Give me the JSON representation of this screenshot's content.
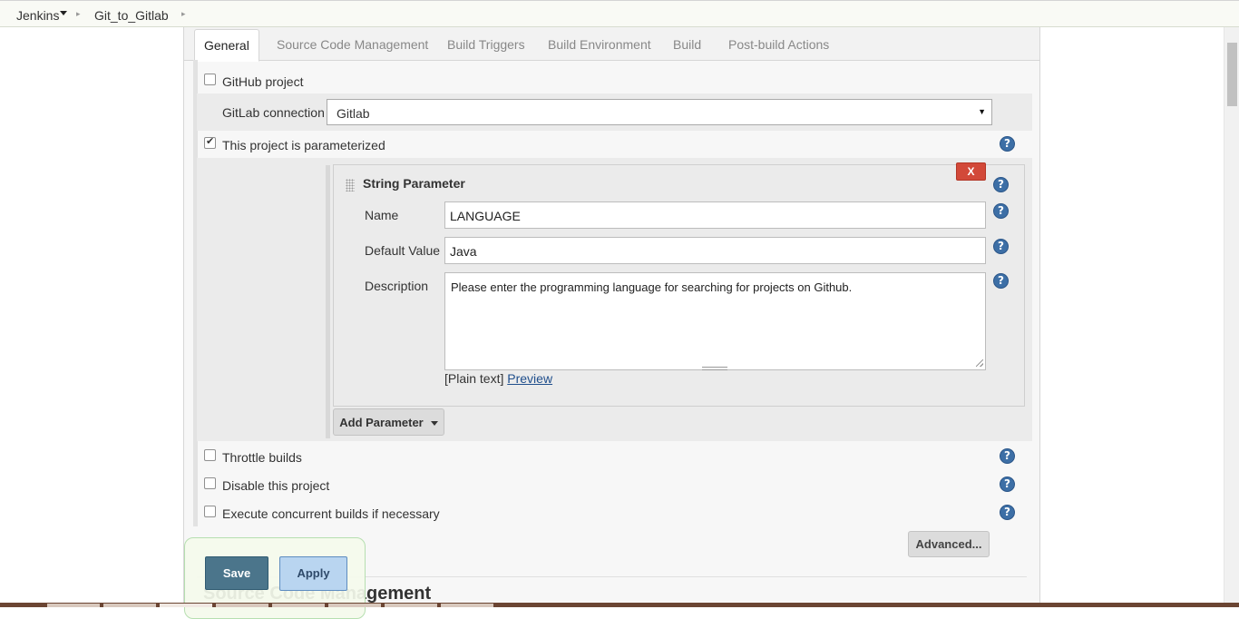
{
  "breadcrumb": {
    "items": [
      "Jenkins",
      "Git_to_Gitlab"
    ]
  },
  "tabs": [
    {
      "label": "General",
      "active": true
    },
    {
      "label": "Source Code Management",
      "active": false
    },
    {
      "label": "Build Triggers",
      "active": false
    },
    {
      "label": "Build Environment",
      "active": false
    },
    {
      "label": "Build",
      "active": false
    },
    {
      "label": "Post-build Actions",
      "active": false
    }
  ],
  "general": {
    "github_project": {
      "label": "GitHub project",
      "checked": false
    },
    "gitlab_connection": {
      "label": "GitLab connection",
      "value": "Gitlab"
    },
    "parameterized": {
      "label": "This project is parameterized",
      "checked": true
    },
    "string_parameter": {
      "title": "String Parameter",
      "delete_label": "X",
      "name_label": "Name",
      "name_value": "LANGUAGE",
      "default_label": "Default Value",
      "default_value": "Java",
      "description_label": "Description",
      "description_value": "Please enter the programming language for searching for projects on Github.",
      "format_label": "[Plain text]",
      "preview_label": "Preview"
    },
    "add_parameter_label": "Add Parameter",
    "throttle_builds": {
      "label": "Throttle builds",
      "checked": false
    },
    "disable_project": {
      "label": "Disable this project",
      "checked": false
    },
    "concurrent_builds": {
      "label": "Execute concurrent builds if necessary",
      "checked": false
    },
    "advanced_label": "Advanced..."
  },
  "next_section_heading": "Source Code Management",
  "actions": {
    "save_label": "Save",
    "apply_label": "Apply"
  },
  "help_icon_glyph": "?",
  "colors": {
    "save_button": "#4b758b",
    "apply_button": "#b9d5f0",
    "delete_button": "#d24939",
    "help_icon": "#3d6fa6"
  }
}
